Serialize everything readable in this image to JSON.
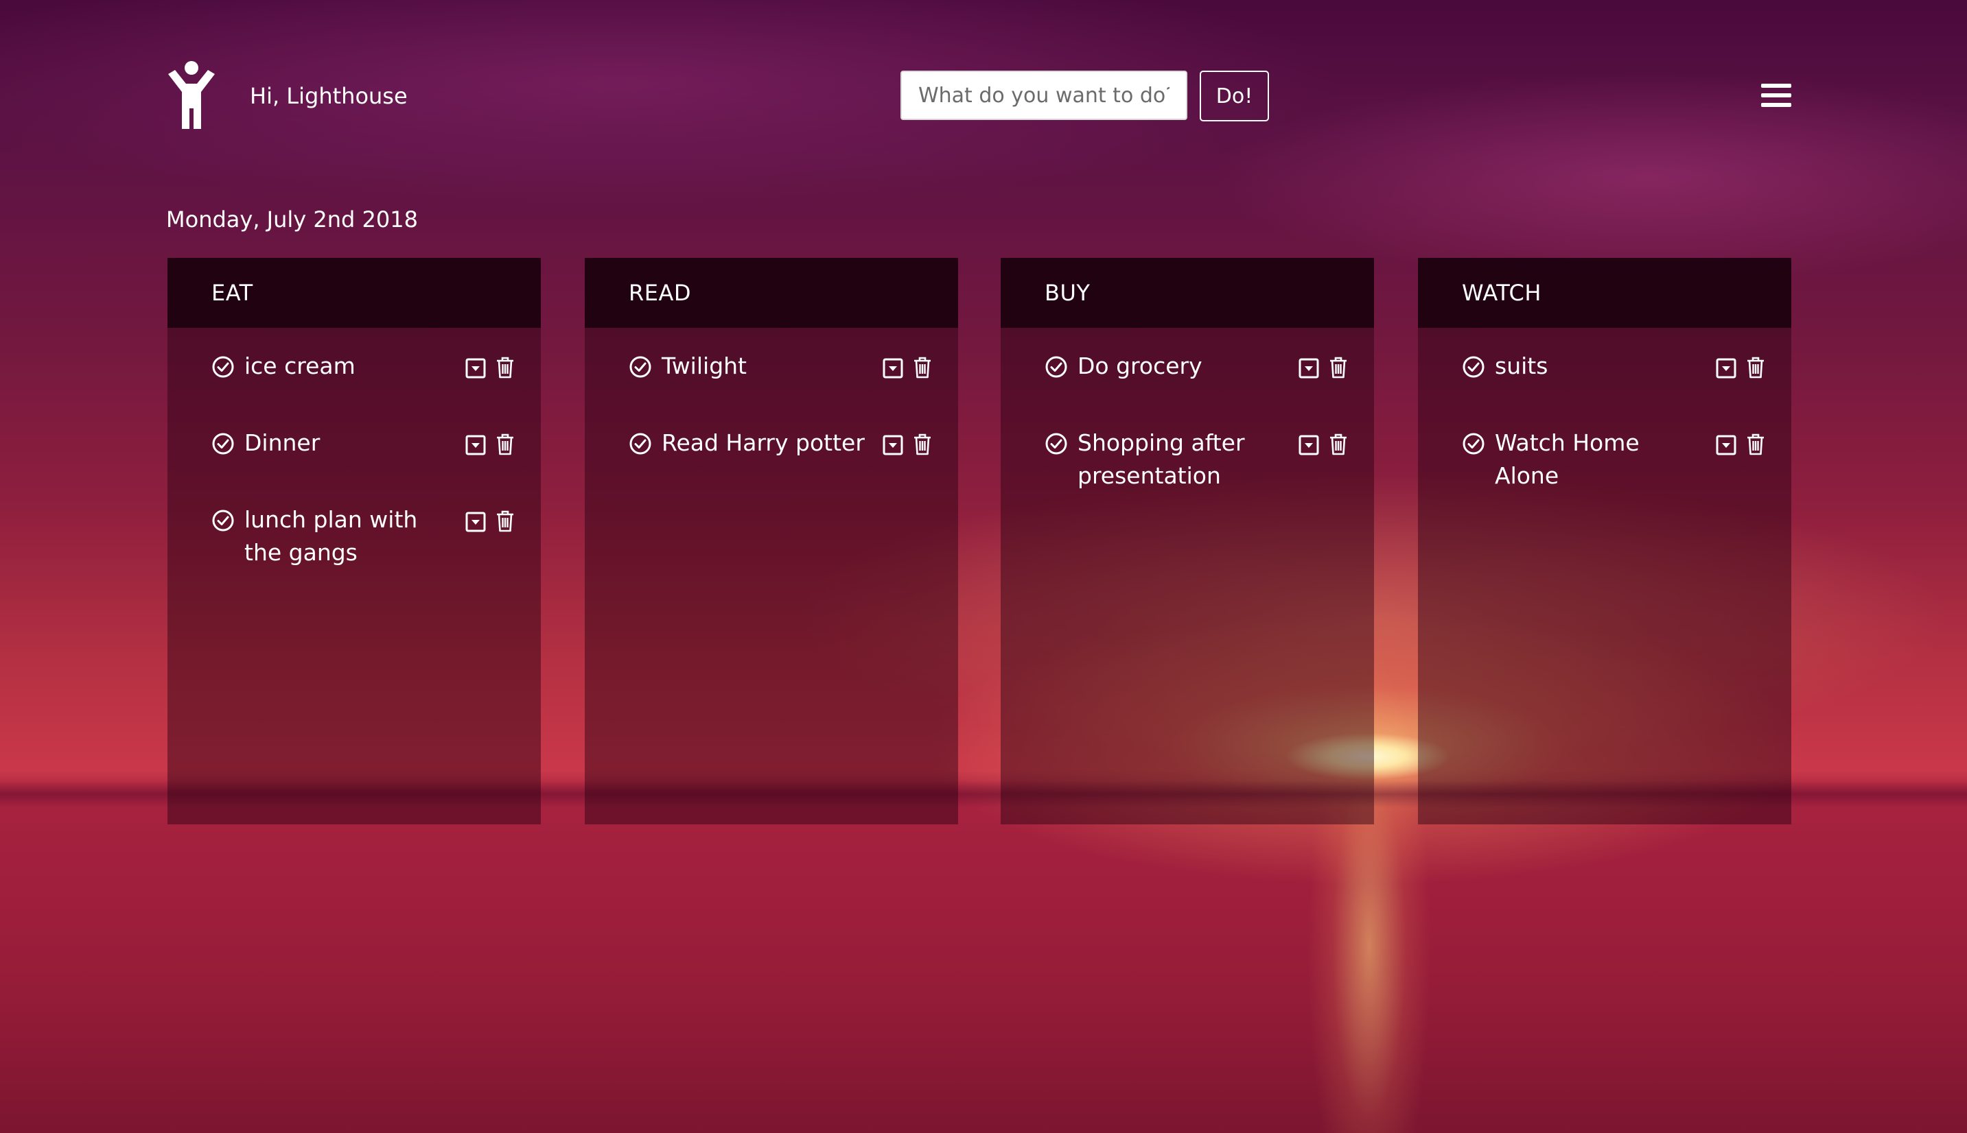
{
  "header": {
    "logo_icon": "person-arms-up-icon",
    "greeting": "Hi, Lighthouse",
    "input_placeholder": "What do you want to do?",
    "do_button_label": "Do!",
    "menu_icon": "hamburger-menu-icon"
  },
  "date": "Monday, July 2nd 2018",
  "columns": [
    {
      "title": "EAT",
      "tasks": [
        {
          "label": "ice cream"
        },
        {
          "label": "Dinner"
        },
        {
          "label": "lunch plan with the gangs"
        }
      ]
    },
    {
      "title": "READ",
      "tasks": [
        {
          "label": "Twilight"
        },
        {
          "label": "Read Harry potter"
        }
      ]
    },
    {
      "title": "BUY",
      "tasks": [
        {
          "label": "Do grocery"
        },
        {
          "label": "Shopping after presentation"
        }
      ]
    },
    {
      "title": "WATCH",
      "tasks": [
        {
          "label": "suits"
        },
        {
          "label": "Watch Home Alone"
        }
      ]
    }
  ],
  "icons": {
    "complete": "check-circle-icon",
    "move": "dropdown-box-icon",
    "delete": "trash-icon"
  },
  "colors": {
    "text": "#ffffff",
    "column_header_bg": "#1c000c"
  }
}
